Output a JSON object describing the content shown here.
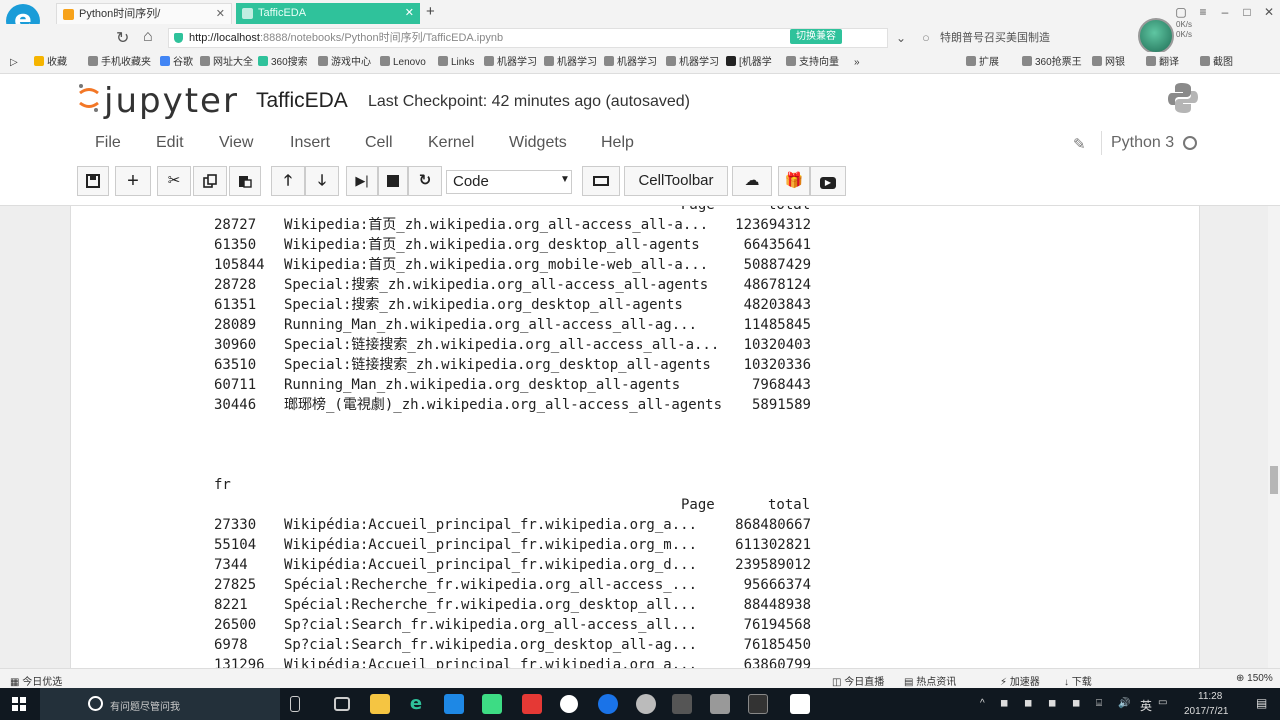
{
  "browser": {
    "logo_letter": "e",
    "tabs": [
      {
        "title": "Python时间序列/",
        "close": "✕"
      },
      {
        "title": "TafficEDA",
        "close": "✕"
      }
    ],
    "new_tab": "+",
    "url_host": "http://localhost",
    "url_rest": ":8888/notebooks/Python时间序列/TafficEDA.ipynb",
    "switch_mode": "切换兼容",
    "search_hint": "特朗普号召买美国制造",
    "net_speed": [
      "0K/s",
      "0K/s"
    ],
    "bookmarks": [
      "收藏",
      "手机收藏夹",
      "谷歌",
      "网址大全",
      "360搜索",
      "游戏中心",
      "Lenovo",
      "Links",
      "机器学习",
      "机器学习",
      "机器学习",
      "机器学习",
      "[机器学",
      "支持向量"
    ],
    "bookmarks_right": [
      "扩展",
      "360抢票王",
      "网银",
      "翻译",
      "截图"
    ]
  },
  "jupyter": {
    "logo_text": "jupyter",
    "notebook_name": "TafficEDA",
    "checkpoint": "Last Checkpoint: 42 minutes ago (autosaved)",
    "menu": [
      "File",
      "Edit",
      "View",
      "Insert",
      "Cell",
      "Kernel",
      "Widgets",
      "Help"
    ],
    "kernel": "Python 3",
    "cell_type": "Code",
    "celltoolbar_label": "CellToolbar",
    "toolbar_icons": [
      "save-icon",
      "plus-icon",
      "cut-icon",
      "copy-icon",
      "paste-icon",
      "arrow-up-icon",
      "arrow-down-icon",
      "run-icon",
      "stop-icon",
      "restart-icon",
      "keyboard-icon",
      "upload-icon",
      "gift-icon",
      "youtube-icon"
    ]
  },
  "output": {
    "zh_header": {
      "page": "Page",
      "total": "total"
    },
    "zh_rows": [
      {
        "idx": "28727",
        "page": "Wikipedia:首页_zh.wikipedia.org_all-access_all-a...",
        "total": "123694312"
      },
      {
        "idx": "61350",
        "page": "Wikipedia:首页_zh.wikipedia.org_desktop_all-agents",
        "total": "66435641"
      },
      {
        "idx": "105844",
        "page": "Wikipedia:首页_zh.wikipedia.org_mobile-web_all-a...",
        "total": "50887429"
      },
      {
        "idx": "28728",
        "page": "Special:搜索_zh.wikipedia.org_all-access_all-agents",
        "total": "48678124"
      },
      {
        "idx": "61351",
        "page": "Special:搜索_zh.wikipedia.org_desktop_all-agents",
        "total": "48203843"
      },
      {
        "idx": "28089",
        "page": "Running_Man_zh.wikipedia.org_all-access_all-ag...",
        "total": "11485845"
      },
      {
        "idx": "30960",
        "page": "Special:链接搜索_zh.wikipedia.org_all-access_all-a...",
        "total": "10320403"
      },
      {
        "idx": "63510",
        "page": "Special:链接搜索_zh.wikipedia.org_desktop_all-agents",
        "total": "10320336"
      },
      {
        "idx": "60711",
        "page": "Running_Man_zh.wikipedia.org_desktop_all-agents",
        "total": "7968443"
      },
      {
        "idx": "30446",
        "page": "瑯琊榜_(電視劇)_zh.wikipedia.org_all-access_all-agents",
        "total": "5891589"
      }
    ],
    "fr_label": "fr",
    "fr_header": {
      "page": "Page",
      "total": "total"
    },
    "fr_rows": [
      {
        "idx": "27330",
        "page": "Wikipédia:Accueil_principal_fr.wikipedia.org_a...",
        "total": "868480667"
      },
      {
        "idx": "55104",
        "page": "Wikipédia:Accueil_principal_fr.wikipedia.org_m...",
        "total": "611302821"
      },
      {
        "idx": "7344",
        "page": "Wikipédia:Accueil_principal_fr.wikipedia.org_d...",
        "total": "239589012"
      },
      {
        "idx": "27825",
        "page": "Spécial:Recherche_fr.wikipedia.org_all-access_...",
        "total": "95666374"
      },
      {
        "idx": "8221",
        "page": "Spécial:Recherche_fr.wikipedia.org_desktop_all...",
        "total": "88448938"
      },
      {
        "idx": "26500",
        "page": "Sp?cial:Search_fr.wikipedia.org_all-access_all...",
        "total": "76194568"
      },
      {
        "idx": "6978",
        "page": "Sp?cial:Search_fr.wikipedia.org_desktop_all-ag...",
        "total": "76185450"
      },
      {
        "idx": "131296",
        "page": "Wikipédia:Accueil_principal_fr.wikipedia.org_a...",
        "total": "63860799"
      }
    ]
  },
  "statusbar": {
    "left": "今日优选",
    "items": [
      "今日直播",
      "热点资讯",
      "加速器",
      "下载"
    ],
    "zoom": "150%"
  },
  "taskbar": {
    "search_text": "有问题尽管问我",
    "ime": "英",
    "time": "11:28",
    "date": "2017/7/21"
  },
  "colors": {
    "accent": "#2fc29b",
    "taskbar": "#101820",
    "jupyter_orange": "#f37726"
  }
}
